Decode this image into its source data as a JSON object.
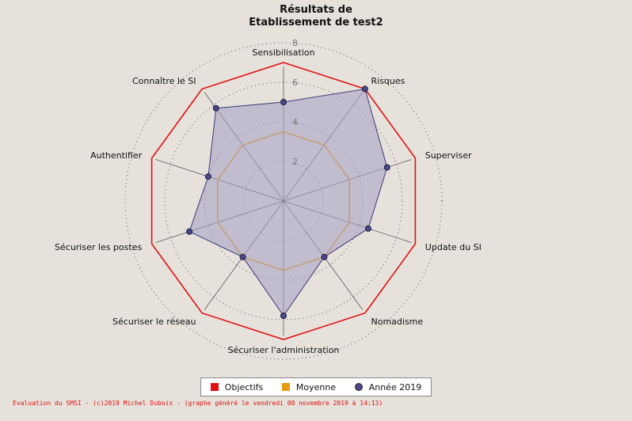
{
  "chart_data": {
    "type": "radar",
    "title_line1": "Résultats de",
    "title_line2": "Etablissement de test2",
    "categories": [
      "Sensibilisation",
      "Risques",
      "Superviser",
      "Update du SI",
      "Nomadisme",
      "Sécuriser l'administration",
      "Sécuriser le réseau",
      "Sécuriser les postes",
      "Authentifier",
      "Connaître le SI"
    ],
    "rmax": 8,
    "ticks": [
      "2",
      "4",
      "6",
      "8"
    ],
    "grid": true,
    "legend_position": "bottom",
    "series": [
      {
        "name": "Objectifs",
        "color": "#e01010",
        "style": "line",
        "values": [
          7,
          7,
          7,
          7,
          7,
          7,
          7,
          7,
          7,
          7
        ]
      },
      {
        "name": "Moyenne",
        "color": "#e89a10",
        "style": "line",
        "values": [
          3.5,
          3.5,
          3.5,
          3.5,
          3.5,
          3.5,
          3.5,
          3.5,
          3.5,
          3.5
        ]
      },
      {
        "name": "Année 2019",
        "color": "#3d3a7a",
        "fill": "#a9a4c4",
        "style": "area",
        "values": [
          5,
          7,
          5.5,
          4.5,
          3.5,
          5.8,
          3.5,
          5,
          4,
          5.8
        ]
      }
    ]
  },
  "footer": "Evaluation du SMSI - (c)2019 Michel Dubois - (graphe généré le vendredi 08 novembre 2019 à 14:13)"
}
